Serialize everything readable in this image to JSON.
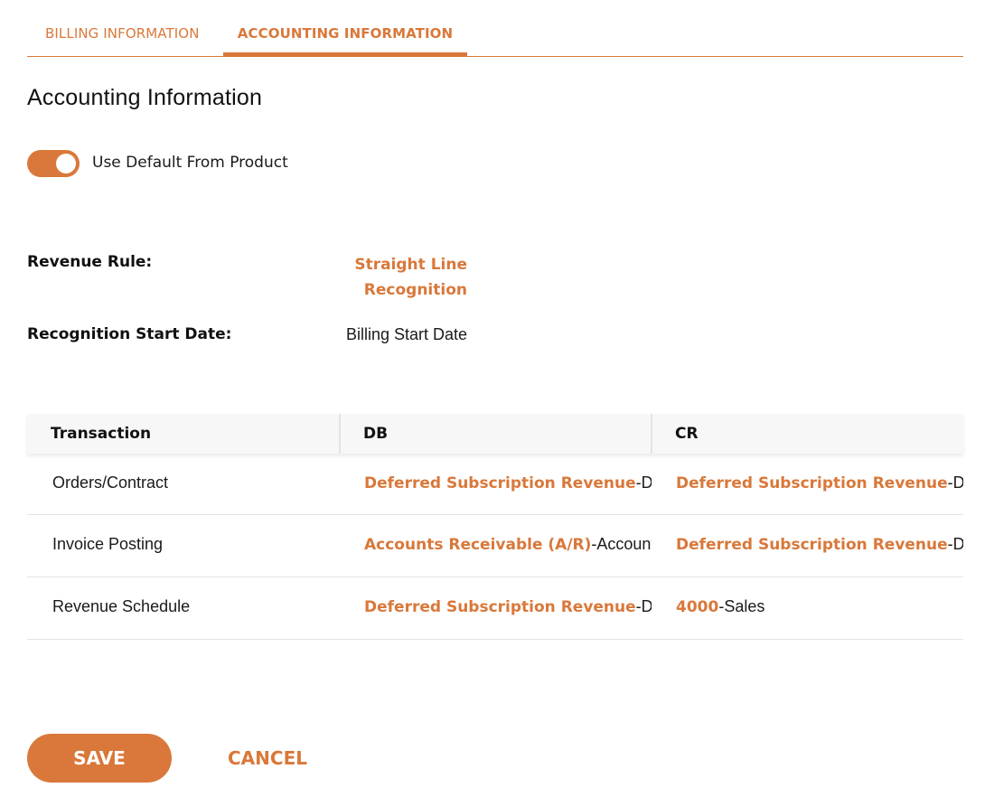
{
  "tabs": [
    {
      "label": "BILLING INFORMATION",
      "active": false
    },
    {
      "label": "ACCOUNTING INFORMATION",
      "active": true
    }
  ],
  "page_title": "Accounting Information",
  "toggle": {
    "label": "Use Default From Product",
    "on": true
  },
  "fields": {
    "revenue_rule": {
      "label": "Revenue Rule:",
      "value": "Straight Line Recognition"
    },
    "recognition_start_date": {
      "label": "Recognition Start Date:",
      "value": "Billing Start Date"
    }
  },
  "table": {
    "headers": [
      "Transaction",
      "DB",
      "CR"
    ],
    "rows": [
      {
        "transaction": "Orders/Contract",
        "db": {
          "account": "Deferred Subscription Revenue",
          "description": "-De"
        },
        "cr": {
          "account": "Deferred Subscription Revenue",
          "description": "-De"
        }
      },
      {
        "transaction": "Invoice Posting",
        "db": {
          "account": "Accounts Receivable (A/R)",
          "description": "-Accounts"
        },
        "cr": {
          "account": "Deferred Subscription Revenue",
          "description": "-De"
        }
      },
      {
        "transaction": "Revenue Schedule",
        "db": {
          "account": "Deferred Subscription Revenue",
          "description": "-De"
        },
        "cr": {
          "account": "4000",
          "description": "-Sales"
        }
      }
    ]
  },
  "buttons": {
    "save": "SAVE",
    "cancel": "CANCEL"
  },
  "colors": {
    "accent": "#d9783a",
    "header_bg": "#f7f7f8",
    "row_border": "#e4e4e4"
  }
}
